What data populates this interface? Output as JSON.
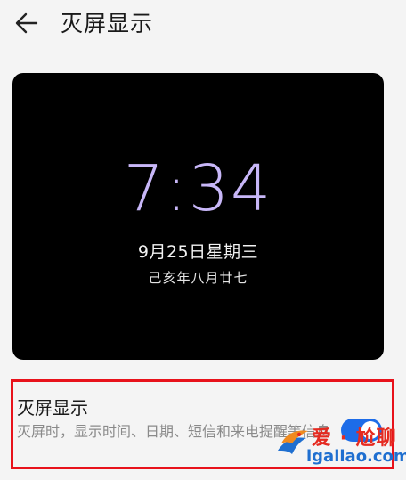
{
  "header": {
    "back_icon": "arrow-left-icon",
    "title": "灭屏显示"
  },
  "preview": {
    "time": "7:34",
    "date": "9月25日星期三",
    "lunar_date": "己亥年八月廿七",
    "time_color": "#c8b7f8",
    "background": "#000000"
  },
  "setting": {
    "title": "灭屏显示",
    "description": "灭屏时，显示时间、日期、短信和来电提醒等信息",
    "toggle_on": true,
    "toggle_color": "#1d6ce8",
    "highlight_color": "#e8121b"
  },
  "watermark": {
    "top_text": "爱 · 尬聊",
    "bottom_text": "igaliao.com",
    "logo_icon": "bird-logo"
  }
}
